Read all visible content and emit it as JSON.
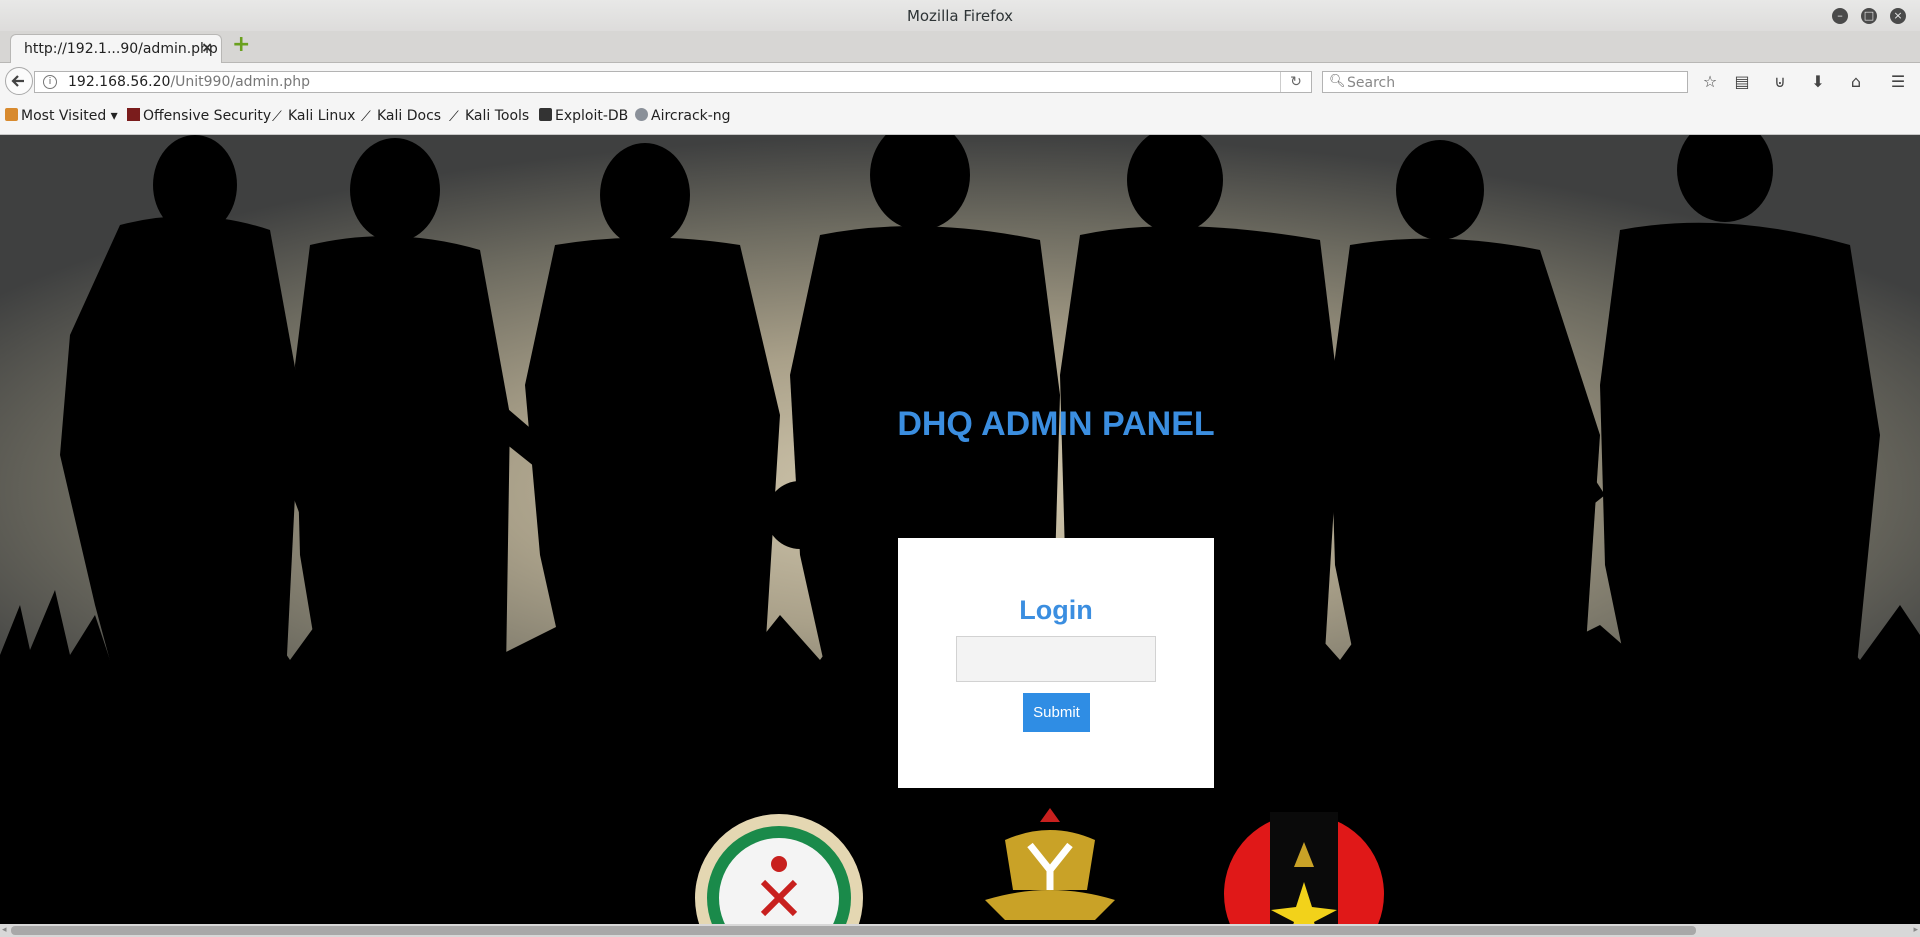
{
  "window": {
    "title": "Mozilla Firefox"
  },
  "tab": {
    "label": "http://192.1...90/admin.php",
    "close": "×"
  },
  "new_tab": "+",
  "nav": {
    "url_host": "192.168.56.20",
    "url_path": "/Unit990/admin.php",
    "search_placeholder": "Search"
  },
  "bookmarks": [
    {
      "label": "Most Visited",
      "icon": "folder-icon"
    },
    {
      "label": "Offensive Security",
      "icon": "offsec-icon"
    },
    {
      "label": "Kali Linux",
      "icon": "kali-dragon-icon"
    },
    {
      "label": "Kali Docs",
      "icon": "kali-dragon-icon"
    },
    {
      "label": "Kali Tools",
      "icon": "kali-dragon-icon"
    },
    {
      "label": "Exploit-DB",
      "icon": "exploitdb-icon"
    },
    {
      "label": "Aircrack-ng",
      "icon": "aircrack-icon"
    }
  ],
  "page": {
    "panel_title": "DHQ ADMIN PANEL",
    "login_heading": "Login",
    "login_input_value": "",
    "submit_label": "Submit"
  },
  "colors": {
    "accent": "#3b8ee0",
    "button": "#2f8de4"
  }
}
